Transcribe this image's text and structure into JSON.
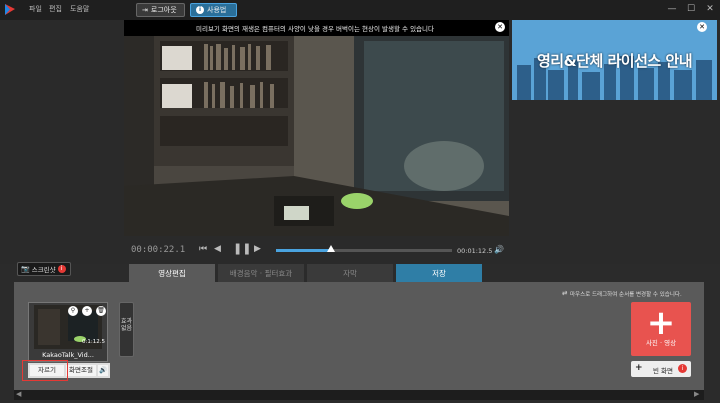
{
  "menu": [
    "파일",
    "편집",
    "도움말"
  ],
  "toolbar": {
    "logout_label": "로그아웃",
    "help_label": "사용법"
  },
  "window_controls": {
    "minimize": "—",
    "maximize": "☐",
    "close": "✕"
  },
  "preview": {
    "notice": "미리보기 화면의 재생은 컴퓨터의 사양이 낮을 경우 버벅이는 현상이 발생할 수 있습니다",
    "ad_title": "영리&단체 라이선스 안내",
    "time_current": "00:00:22.1",
    "time_total": "00:01:12.5",
    "progress": 0.31
  },
  "screenshot_label": "스크린샷",
  "tabs": [
    {
      "label": "영상편집",
      "state": "active"
    },
    {
      "label": "배경음악 · 필터효과",
      "state": "inactive"
    },
    {
      "label": "자막",
      "state": "inactive"
    },
    {
      "label": "저장",
      "state": "save"
    }
  ],
  "editor": {
    "hint": "마우스로 드래그하여 순서를 변경할 수 있습니다.",
    "clip": {
      "name": "KakaoTalk_Vid...",
      "duration": "0:1:12.5",
      "tools": {
        "trim_label": "자르기",
        "screen_label": "화면조절"
      }
    },
    "effect_label": "효과없음",
    "add_media_label": "사진 · 영상",
    "blank_screen_label": "빈 화면"
  },
  "colors": {
    "accent_blue": "#4aa3df",
    "add_red": "#e8534f",
    "save_tab": "#2f7ea6"
  }
}
